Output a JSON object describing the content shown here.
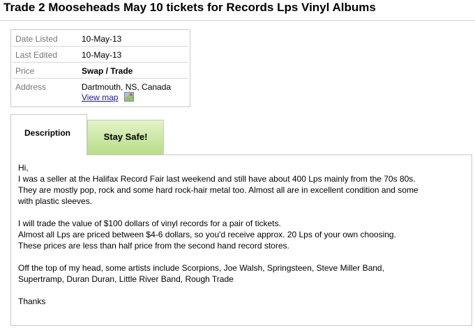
{
  "listing": {
    "title": "Trade 2 Mooseheads May 10 tickets for Records Lps Vinyl Albums"
  },
  "details": {
    "date_listed_label": "Date Listed",
    "date_listed_value": "10-May-13",
    "last_edited_label": "Last Edited",
    "last_edited_value": "10-May-13",
    "price_label": "Price",
    "price_value": "Swap / Trade",
    "address_label": "Address",
    "address_value": "Dartmouth, NS, Canada",
    "view_map_label": "View map"
  },
  "tabs": [
    {
      "label": "Description",
      "active": true
    },
    {
      "label": "Stay Safe!",
      "active": false
    }
  ],
  "description": {
    "paragraphs": [
      "Hi,\nI was a seller at the Halifax Record Fair last weekend and still have about 400 Lps mainly from the 70s 80s.\nThey are mostly pop, rock and some hard rock-hair metal too. Almost all are in excellent condition and some\nwith plastic sleeves.",
      "I will trade the value of $100 dollars of vinyl records for a pair of tickets.\nAlmost all Lps are priced between $4-6 dollars, so you'd receive approx. 20 Lps of your own choosing.\nThese prices are less than half price from the second hand record stores.",
      "Off the top of my head, some artists include Scorpions, Joe Walsh, Springsteen, Steve Miller Band,\nSupertramp, Duran Duran, Little River Band, Rough Trade",
      "Thanks"
    ]
  },
  "colors": {
    "stay_safe_tab_top": "#e3f3c8",
    "stay_safe_tab_bottom": "#b7dd87",
    "border": "#c8c8c8",
    "label_text": "#777777",
    "link": "#1a1a8a"
  },
  "icons": {
    "map": "map-icon"
  }
}
